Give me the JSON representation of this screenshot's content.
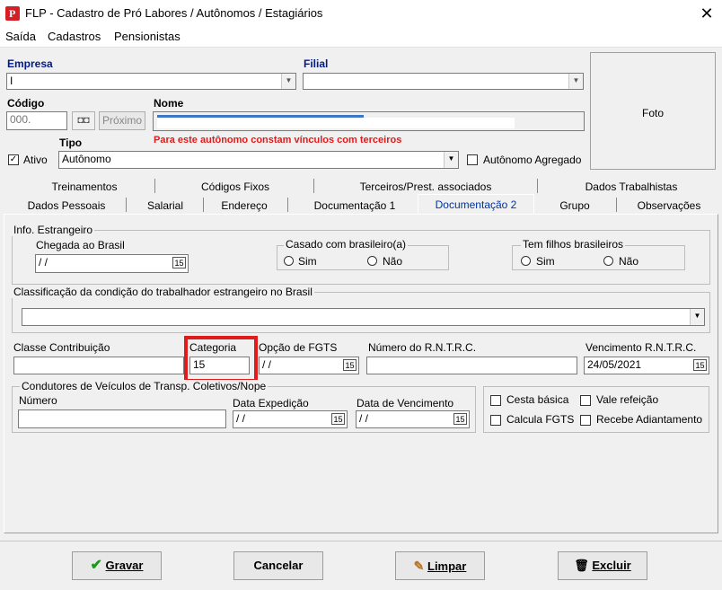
{
  "window": {
    "title": "FLP - Cadastro de Pró Labores / Autônomos / Estagiários",
    "icon_letter": "P"
  },
  "menu": [
    "Saída",
    "Cadastros",
    "Pensionistas"
  ],
  "header": {
    "empresa_label": "Empresa",
    "empresa_value": "I",
    "filial_label": "Filial",
    "codigo_label": "Código",
    "codigo_value": "000.",
    "proximo_label": "Próximo",
    "nome_label": "Nome",
    "warning": "Para este autônomo constam vínculos com terceiros",
    "ativo_label": "Ativo",
    "tipo_label": "Tipo",
    "tipo_value": "Autônomo",
    "agregado_label": "Autônomo Agregado",
    "foto_label": "Foto"
  },
  "tabs_row1": [
    "Treinamentos",
    "Códigos Fixos",
    "Terceiros/Prest. associados",
    "Dados Trabalhistas"
  ],
  "tabs_row2": [
    "Dados Pessoais",
    "Salarial",
    "Endereço",
    "Documentação 1",
    "Documentação 2",
    "Grupo",
    "Observações"
  ],
  "active_tab": "Documentação 2",
  "estrangeiro": {
    "legend": "Info. Estrangeiro",
    "chegada_label": "Chegada ao Brasil",
    "chegada_value": "/ /",
    "casado_legend": "Casado com brasileiro(a)",
    "filhos_legend": "Tem filhos brasileiros",
    "sim": "Sim",
    "nao": "Não",
    "classificacao_legend": "Classificação da condição do trabalhador estrangeiro no Brasil"
  },
  "contrib": {
    "classe_label": "Classe Contribuição",
    "categoria_label": "Categoria",
    "categoria_value": "15",
    "fgts_label": "Opção de FGTS",
    "fgts_value": "/ /",
    "rntrc_label": "Número do R.N.T.R.C.",
    "venc_label": "Vencimento R.N.T.R.C.",
    "venc_value": "24/05/2021"
  },
  "condutores": {
    "legend": "Condutores de Veículos de Transp. Coletivos/Nope",
    "numero_label": "Número",
    "expedicao_label": "Data Expedição",
    "expedicao_value": "/ /",
    "vencimento_label": "Data de Vencimento",
    "vencimento_value": "/ /"
  },
  "checks": {
    "cesta": "Cesta básica",
    "vale": "Vale refeição",
    "fgts": "Calcula FGTS",
    "adiantamento": "Recebe Adiantamento"
  },
  "icons": {
    "calendar": "15"
  },
  "buttons": {
    "gravar": "Gravar",
    "cancelar": "Cancelar",
    "limpar": "Limpar",
    "excluir": "Excluir"
  },
  "colors": {
    "highlight": "#e11b1b",
    "warning": "#e11b1b",
    "active_tab": "#0033a0"
  }
}
